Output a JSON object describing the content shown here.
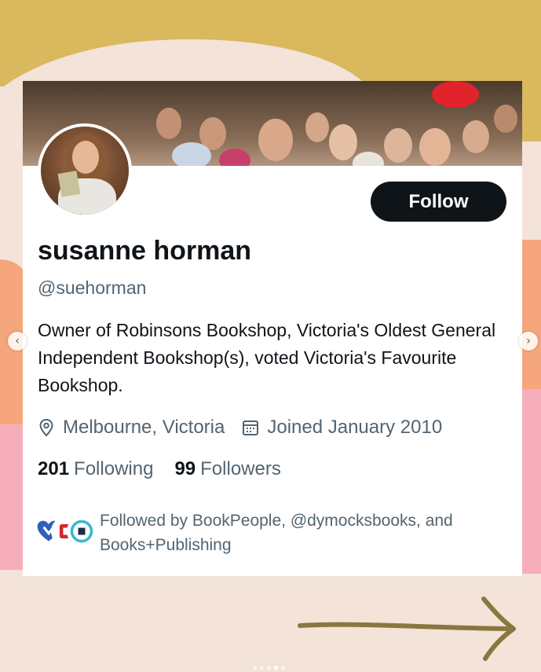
{
  "profile": {
    "name": "susanne horman",
    "handle": "@suehorman",
    "bio": "Owner of Robinsons Bookshop, Victoria's Oldest General Independent Bookshop(s), voted Victoria's Favourite Bookshop.",
    "location": "Melbourne, Victoria",
    "joined": "Joined January 2010",
    "follow_label": "Follow"
  },
  "stats": {
    "following_count": "201",
    "following_label": "Following",
    "followers_count": "99",
    "followers_label": "Followers"
  },
  "followed_by": {
    "text": "Followed by BookPeople, @dymocksbooks, and Books+Publishing"
  },
  "icons": {
    "location": "location-pin-icon",
    "joined": "calendar-icon",
    "prev": "chevron-left-icon",
    "next": "chevron-right-icon",
    "swipe": "arrow-right-icon"
  },
  "colors": {
    "follow_button": "#0f1419",
    "secondary_text": "#536471",
    "primary_text": "#0f1419",
    "background_gold": "#d9b85e",
    "background_orange": "#f5a67c",
    "background_pink": "#f7aebb",
    "background_cream": "#f3e3d8",
    "arrow": "#8a7740"
  },
  "carousel": {
    "slide_count": 5,
    "active_slide": 4
  }
}
